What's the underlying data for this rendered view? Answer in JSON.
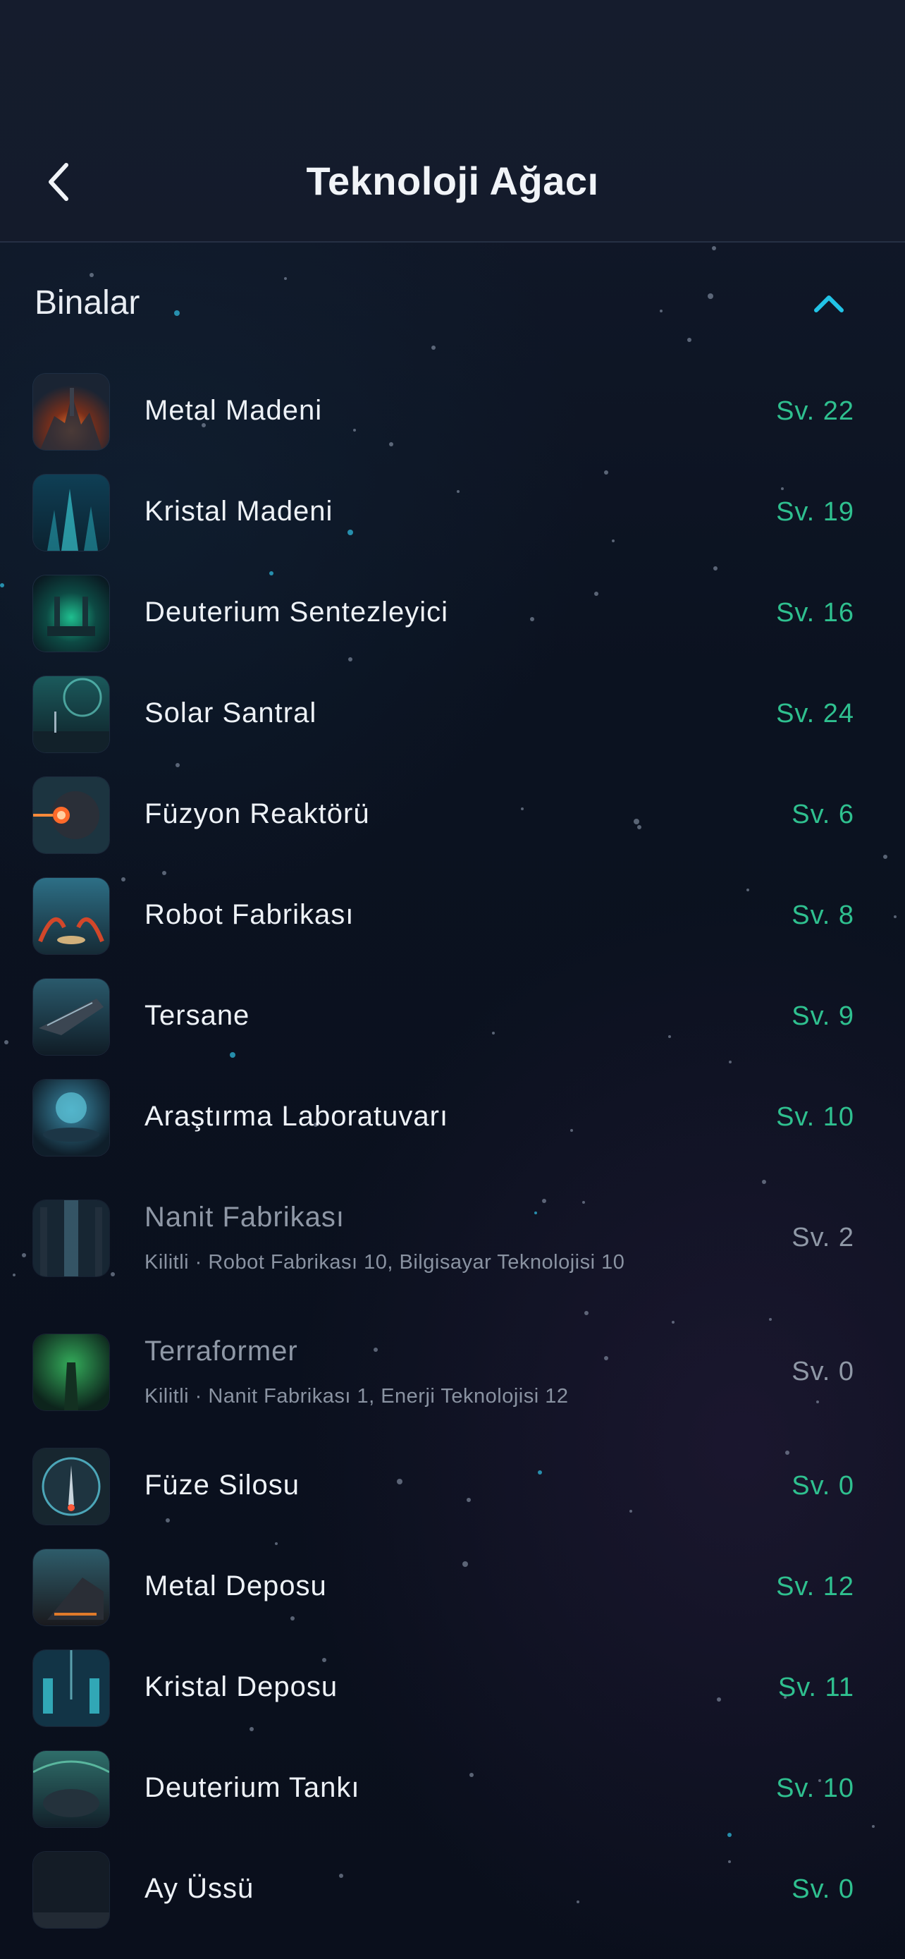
{
  "header": {
    "title": "Teknoloji Ağacı",
    "back_icon": "chevron-left-icon"
  },
  "section": {
    "title": "Binalar",
    "collapse_icon": "chevron-up-icon",
    "accent_color": "#22c3e6"
  },
  "colors": {
    "level_active": "#2fc08f",
    "level_locked": "#8f98a6",
    "name_active": "#eef2f7",
    "name_locked": "#8f98a6"
  },
  "buildings": [
    {
      "name": "Metal Madeni",
      "level": "Sv. 22",
      "locked": false,
      "image": "metal-mine-thumbnail"
    },
    {
      "name": "Kristal Madeni",
      "level": "Sv. 19",
      "locked": false,
      "image": "crystal-mine-thumbnail"
    },
    {
      "name": "Deuterium Sentezleyici",
      "level": "Sv. 16",
      "locked": false,
      "image": "deuterium-synthesizer-thumbnail"
    },
    {
      "name": "Solar Santral",
      "level": "Sv. 24",
      "locked": false,
      "image": "solar-plant-thumbnail"
    },
    {
      "name": "Füzyon Reaktörü",
      "level": "Sv. 6",
      "locked": false,
      "image": "fusion-reactor-thumbnail"
    },
    {
      "name": "Robot Fabrikası",
      "level": "Sv. 8",
      "locked": false,
      "image": "robot-factory-thumbnail"
    },
    {
      "name": "Tersane",
      "level": "Sv. 9",
      "locked": false,
      "image": "shipyard-thumbnail"
    },
    {
      "name": "Araştırma Laboratuvarı",
      "level": "Sv. 10",
      "locked": false,
      "image": "research-lab-thumbnail"
    },
    {
      "name": "Nanit Fabrikası",
      "level": "Sv. 2",
      "locked": true,
      "requirement": "Kilitli · Robot Fabrikası 10, Bilgisayar Teknolojisi 10",
      "image": "nanite-factory-thumbnail"
    },
    {
      "name": "Terraformer",
      "level": "Sv. 0",
      "locked": true,
      "requirement": "Kilitli · Nanit Fabrikası 1, Enerji Teknolojisi 12",
      "image": "terraformer-thumbnail"
    },
    {
      "name": "Füze Silosu",
      "level": "Sv. 0",
      "locked": false,
      "image": "missile-silo-thumbnail"
    },
    {
      "name": "Metal Deposu",
      "level": "Sv. 12",
      "locked": false,
      "image": "metal-storage-thumbnail"
    },
    {
      "name": "Kristal Deposu",
      "level": "Sv. 11",
      "locked": false,
      "image": "crystal-storage-thumbnail"
    },
    {
      "name": "Deuterium Tankı",
      "level": "Sv. 10",
      "locked": false,
      "image": "deuterium-tank-thumbnail"
    },
    {
      "name": "Ay Üssü",
      "level": "Sv. 0",
      "locked": false,
      "image": "moon-base-thumbnail"
    }
  ]
}
